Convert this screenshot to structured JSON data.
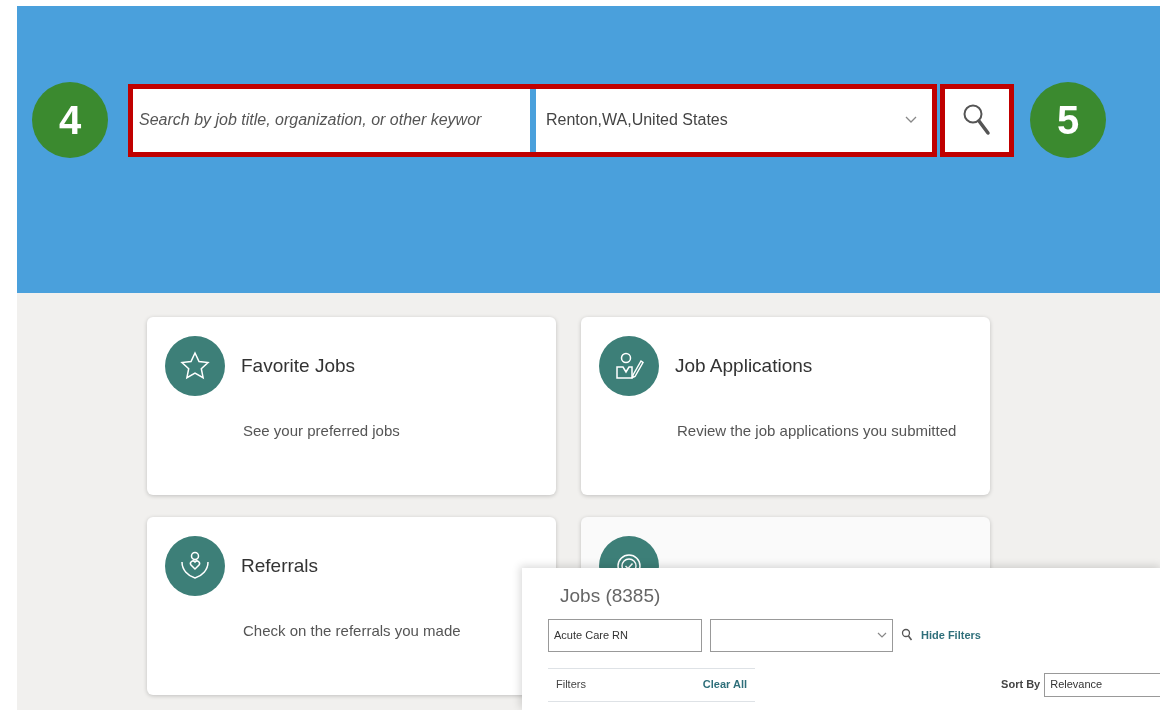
{
  "search": {
    "step_badge": "4",
    "keyword": {
      "placeholder": "Search by job title, organization, or other keywor"
    },
    "location": {
      "value": "Renton,WA,United States"
    },
    "button_badge": "5"
  },
  "cards": [
    {
      "kind": "full",
      "title": "Favorite Jobs",
      "description": "See your preferred jobs"
    },
    {
      "kind": "full",
      "title": "Job Applications",
      "description": "Review the job applications you submitted"
    },
    {
      "kind": "full",
      "title": "Referrals",
      "description": "Check on the referrals you made"
    },
    {
      "kind": "covered"
    }
  ],
  "jobs_panel": {
    "title": "Jobs (8385)",
    "keyword_value": "Acute Care RN",
    "hide_filters": "Hide Filters",
    "filters_label": "Filters",
    "clear_all": "Clear All",
    "sort_label": "Sort By",
    "sort_value": "Relevance"
  }
}
